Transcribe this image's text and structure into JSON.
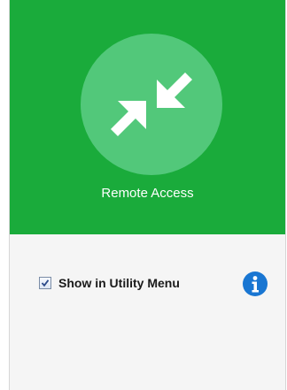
{
  "app": {
    "title": "Remote Access",
    "icon": "compress-arrows-icon"
  },
  "options": {
    "show_in_utility_menu": {
      "label": "Show in Utility Menu",
      "checked": true
    },
    "info_icon": "info-icon"
  },
  "colors": {
    "header_bg": "#1aab3b",
    "icon_circle": "#52c87a",
    "info_blue": "#1976d2"
  }
}
